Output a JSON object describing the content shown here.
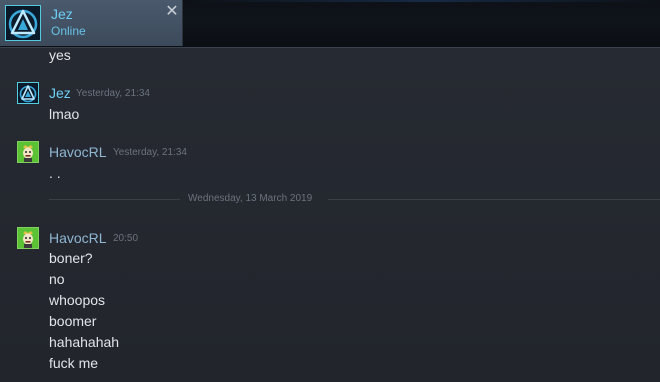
{
  "tab": {
    "name": "Jez",
    "status": "Online",
    "close_glyph": "✕",
    "avatar_icon": "triangle-logo-icon"
  },
  "colors": {
    "accent": "#6dcff6",
    "friend_name": "#8fb6d3",
    "message_text": "#e1e4e8",
    "timestamp": "#6b737e"
  },
  "chat": {
    "top_fragment": "yes",
    "groups": [
      {
        "sender": "Jez",
        "timestamp": "Yesterday, 21:34",
        "messages": [
          "lmao"
        ]
      },
      {
        "sender": "HavocRL",
        "timestamp": "Yesterday, 21:34",
        "messages": [
          ". ."
        ]
      },
      {
        "sender": "HavocRL",
        "timestamp": "20:50",
        "messages": [
          "boner?",
          "no",
          "whoopos",
          "boomer",
          "hahahahah",
          "fuck me"
        ]
      }
    ],
    "date_divider": "Wednesday, 13 March 2019"
  }
}
